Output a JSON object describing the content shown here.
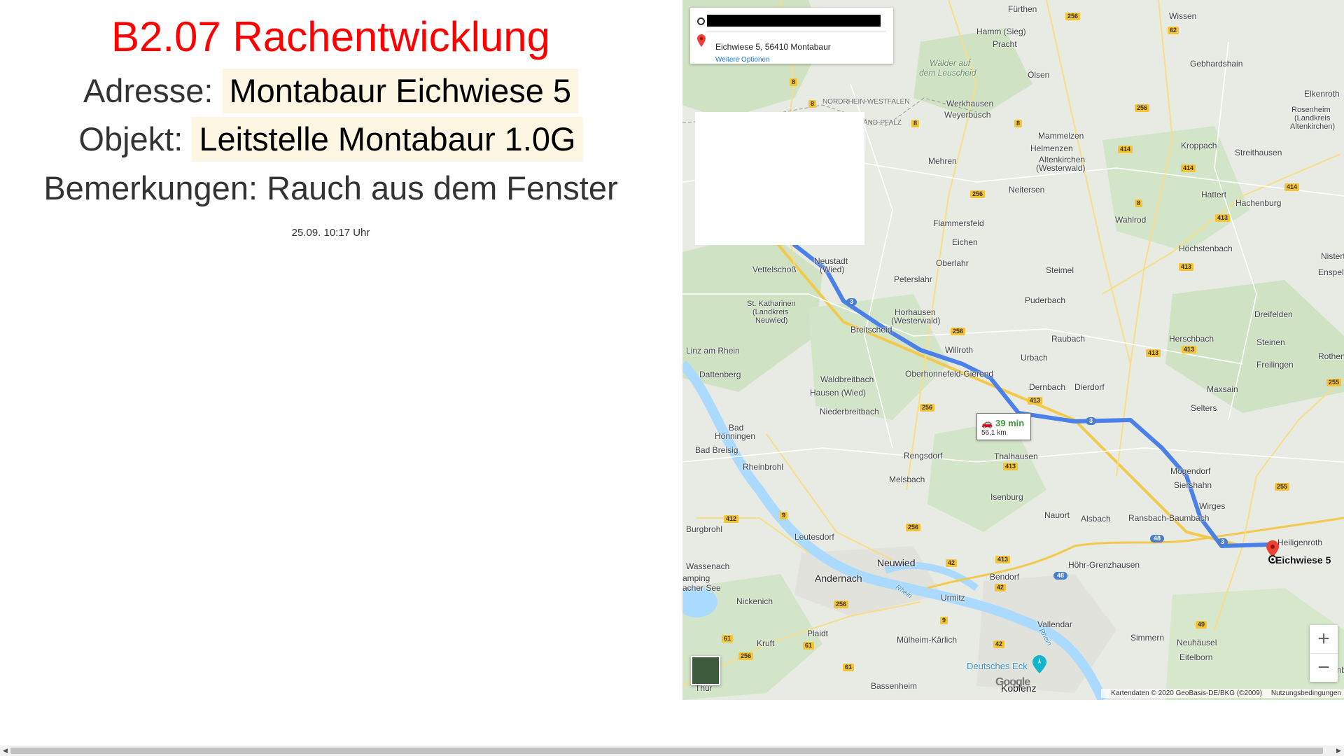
{
  "incident": {
    "title": "B2.07 Rachentwicklung",
    "address_label": "Adresse:",
    "address_value": "Montabaur Eichwiese 5",
    "object_label": "Objekt:",
    "object_value": "Leitstelle Montabaur 1.0G",
    "remarks": "Bemerkungen: Rauch aus dem Fenster",
    "timestamp": "25.09. 10:17 Uhr"
  },
  "map": {
    "directions": {
      "destination": "Eichwiese 5, 56410 Montabaur",
      "options_link": "Weitere Optionen"
    },
    "route": {
      "duration": "39 min",
      "distance": "56,1 km",
      "color": "#4a80e8"
    },
    "destination_marker": "Eichwiese 5",
    "zoom_in": "+",
    "zoom_out": "−",
    "logo": "Google",
    "attribution": "Kartendaten © 2020 GeoBasis-DE/BKG (©2009)",
    "terms": "Nutzungsbedingungen",
    "labels": {
      "fuerthen": "Fürthen",
      "wissen": "Wissen",
      "hamm": "Hamm (Sieg)",
      "pracht": "Pracht",
      "gebhardshain": "Gebhardshain",
      "elkenroth": "Elkenroth",
      "waelder": "Wälder auf",
      "waelder2": "dem Leuscheid",
      "oelsen": "Ölsen",
      "nrw": "NORDRHEIN-WESTFALEN",
      "rlp": "AND-PFALZ",
      "werkhausen": "Werkhausen",
      "weyerbusch": "Weyerbusch",
      "rosenheim": "Rosenheim",
      "rosenheim2": "(Landkreis",
      "rosenheim3": "Altenkirchen)",
      "mammelzen": "Mammelzen",
      "kroppach": "Kroppach",
      "helmenzen": "Helmenzen",
      "altenkirchen": "Altenkirchen",
      "altenkirchen2": "(Westerwald)",
      "streithausen": "Streithausen",
      "mehren": "Mehren",
      "neitersen": "Neitersen",
      "hattert": "Hattert",
      "hachenburg": "Hachenburg",
      "flammersfeld": "Flammersfeld",
      "wahlrod": "Wahlrod",
      "eichen": "Eichen",
      "hoechstenbach": "Höchstenbach",
      "nister": "Nisterta",
      "oberlahr": "Oberlahr",
      "neustadt": "Neustadt",
      "neustadt2": "(Wied)",
      "vettelschoss": "Vettelschoß",
      "peterslahr": "Peterslahr",
      "steimel": "Steimel",
      "enspel": "Enspel",
      "katharinen": "St. Katharinen",
      "katharinen2": "(Landkreis",
      "katharinen3": "Neuwied)",
      "puderbach": "Puderbach",
      "horhausen": "Horhausen",
      "horhausen2": "(Westerwald)",
      "dreifelden": "Dreifelden",
      "breitscheid": "Breitscheid",
      "raubach": "Raubach",
      "linz": "Linz am Rhein",
      "willroth": "Willroth",
      "herschbach": "Herschbach",
      "steinen": "Steinen",
      "urbach": "Urbach",
      "rothen": "Rothen",
      "dattenberg": "Dattenberg",
      "freilingen": "Freilingen",
      "waldbreitbach": "Waldbreitbach",
      "oberhonnefeld": "Oberhonnefeld-Gierend",
      "dernbach": "Dernbach",
      "dierdorf": "Dierdorf",
      "hausen": "Hausen (Wied)",
      "maxsain": "Maxsain",
      "niederbreitbach": "Niederbreitbach",
      "selters": "Selters",
      "bad": "Bad",
      "hoenningen": "Hönningen",
      "badbreisig": "Bad Breisig",
      "rengsdorf": "Rengsdorf",
      "thalhausen": "Thalhausen",
      "rheinbrohl": "Rheinbrohl",
      "mogendorf": "Mogendorf",
      "melsbach": "Melsbach",
      "siershahn": "Siershahn",
      "isenburg": "Isenburg",
      "wirges": "Wirges",
      "burgbrohl": "Burgbrohl",
      "nauort": "Nauort",
      "alsbach": "Alsbach",
      "ransbach": "Ransbach-Baumbach",
      "leutesdorf": "Leutesdorf",
      "heiligenroth": "Heiligenroth",
      "wassenach": "Wassenach",
      "neuwied": "Neuwied",
      "andernach": "Andernach",
      "hoehr": "Höhr-Grenzhausen",
      "bendorf": "Bendorf",
      "camping": "amping",
      "laachersee": "acher See",
      "rhein": "Rhein",
      "nickenich": "Nickenich",
      "urmitz": "Urmitz",
      "vallendar": "Vallendar",
      "plaidt": "Plaidt",
      "kruft": "Kruft",
      "muelheim": "Mülheim-Kärlich",
      "simmern": "Simmern",
      "neuhaeusel": "Neuhäusel",
      "eitelborn": "Eitelborn",
      "deutsches": "Deutsches Eck",
      "gackenbach": "Gackenb",
      "thuer": "Thür",
      "bassenheim": "Bassenheim",
      "koblenz": "Koblenz",
      "rhein2": "Rhein"
    },
    "shields": {
      "s256a": "256",
      "s62": "62",
      "s8a": "8",
      "s8b": "8",
      "s8c": "8",
      "s8d": "8",
      "s8e": "8",
      "s256b": "256",
      "s414a": "414",
      "s414b": "414",
      "s414c": "414",
      "s256c": "256",
      "s413a": "413",
      "s413b": "413",
      "s256d": "256",
      "s413c": "413",
      "s413d": "413",
      "s256e": "256",
      "s255a": "255",
      "s413e": "413",
      "s413f": "413",
      "s255b": "255",
      "s412": "412",
      "s9a": "9",
      "s256f": "256",
      "s42a": "42",
      "s413g": "413",
      "s42b": "42",
      "s256g": "256",
      "s9b": "9",
      "s61a": "61",
      "s61b": "61",
      "s61c": "61",
      "s256h": "256",
      "s49": "49",
      "s42c": "42",
      "s3a": "3",
      "s3b": "3",
      "s3c": "3",
      "s48a": "48",
      "s48b": "48"
    }
  }
}
